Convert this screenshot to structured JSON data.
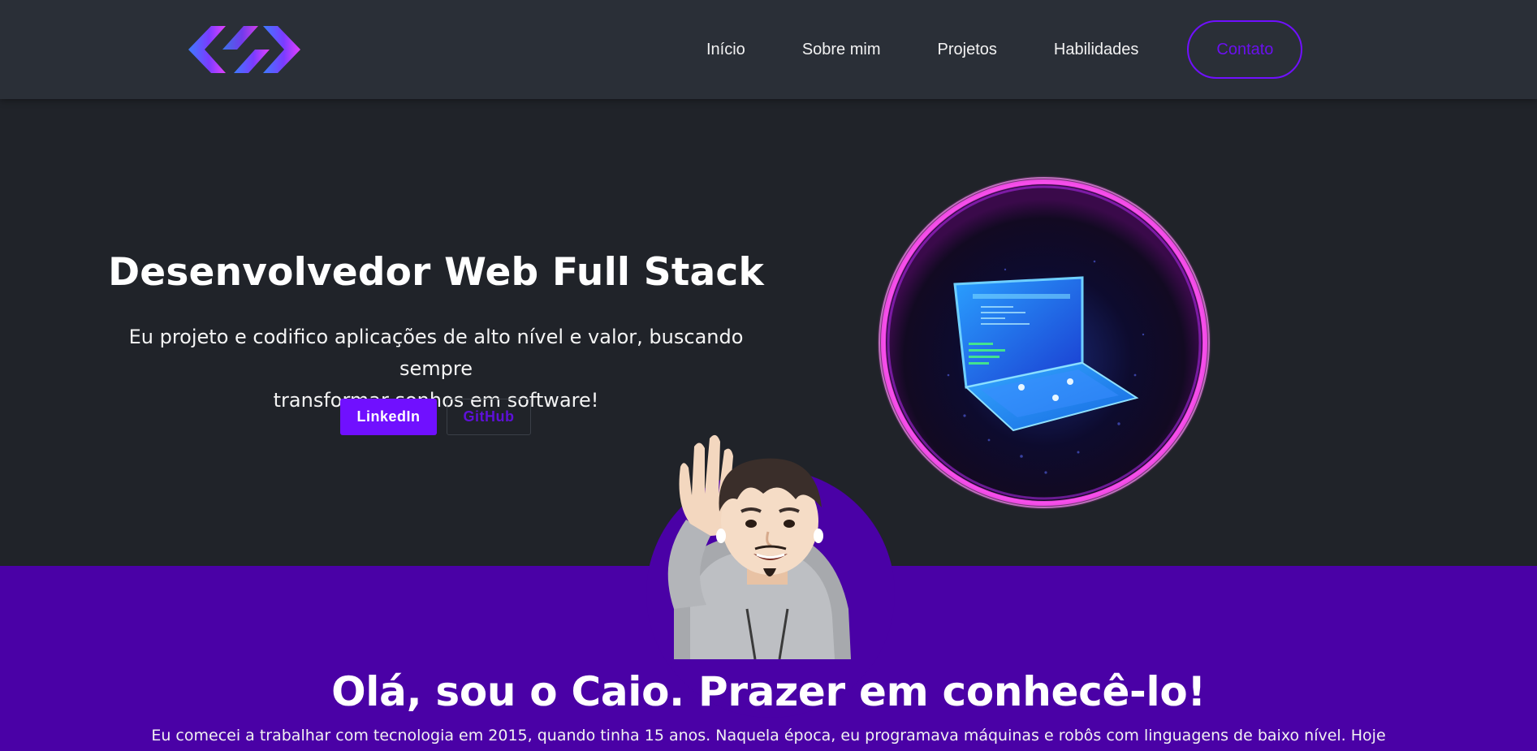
{
  "brand": {
    "logo_icon": "code-brackets-logo-icon",
    "accent_color": "#7010ff"
  },
  "nav": {
    "links": [
      {
        "label": "Início"
      },
      {
        "label": "Sobre mim"
      },
      {
        "label": "Projetos"
      },
      {
        "label": "Habilidades"
      }
    ],
    "contact_label": "Contato"
  },
  "hero": {
    "title": "Desenvolvedor Web Full Stack",
    "description_line1": "Eu projeto e codifico aplicações de alto nível e valor, buscando sempre",
    "description_line2": "transformar sonhos em software!",
    "buttons": {
      "linkedin": "LinkedIn",
      "github": "GitHub"
    },
    "illustration": "laptop-portal-illustration"
  },
  "about": {
    "avatar": "waving-memoji-avatar",
    "title": "Olá, sou o Caio. Prazer em conhecê-lo!",
    "text": "Eu comecei a trabalhar com tecnologia em 2015, quando tinha 15 anos. Naquela época, eu programava máquinas e robôs com linguagens de baixo nível. Hoje",
    "background_color": "#4a01a6"
  }
}
